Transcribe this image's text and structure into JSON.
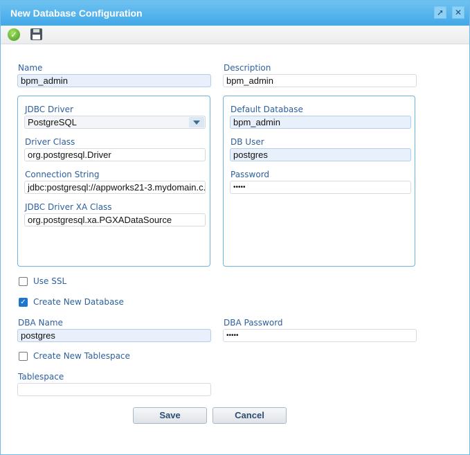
{
  "window": {
    "title": "New Database Configuration",
    "pin_icon": "pin-icon",
    "close_icon": "close-icon"
  },
  "toolbar": {
    "apply_icon": "checkmark-icon",
    "save_icon": "floppy-disk-icon"
  },
  "form": {
    "name": {
      "label": "Name",
      "value": "bpm_admin"
    },
    "description": {
      "label": "Description",
      "value": "bpm_admin"
    },
    "jdbc_driver": {
      "label": "JDBC Driver",
      "value": "PostgreSQL"
    },
    "driver_class": {
      "label": "Driver Class",
      "value": "org.postgresql.Driver"
    },
    "connection_string": {
      "label": "Connection String",
      "value": "jdbc:postgresql://appworks21-3.mydomain.c..."
    },
    "xa_class": {
      "label": "JDBC Driver XA Class",
      "value": "org.postgresql.xa.PGXADataSource"
    },
    "default_database": {
      "label": "Default Database",
      "value": "bpm_admin"
    },
    "db_user": {
      "label": "DB User",
      "value": "postgres"
    },
    "password": {
      "label": "Password",
      "value": "•••••"
    },
    "use_ssl": {
      "label": "Use SSL",
      "checked": false
    },
    "create_db": {
      "label": "Create New Database",
      "checked": true
    },
    "dba_name": {
      "label": "DBA Name",
      "value": "postgres"
    },
    "dba_password": {
      "label": "DBA Password",
      "value": "•••••"
    },
    "create_tablespace": {
      "label": "Create New Tablespace",
      "checked": false
    },
    "tablespace": {
      "label": "Tablespace",
      "value": ""
    }
  },
  "buttons": {
    "save": "Save",
    "cancel": "Cancel"
  }
}
